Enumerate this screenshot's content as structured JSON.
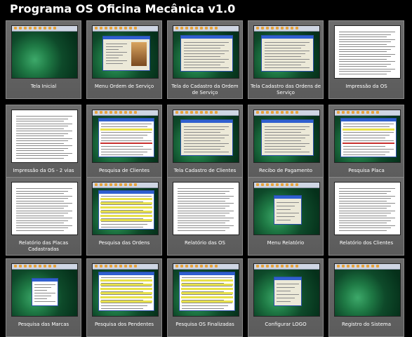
{
  "title": "Programa OS Oficina Mecânica v1.0",
  "cards": [
    {
      "caption": "Tela Inicial"
    },
    {
      "caption": "Menu Ordem de Serviço"
    },
    {
      "caption": "Tela do Cadastro da Ordem de Serviço"
    },
    {
      "caption": "Tela Cadastro das Ordens de Serviço"
    },
    {
      "caption": "Impressão da OS"
    },
    {
      "caption": "Impressão da OS - 2 vias"
    },
    {
      "caption": "Pesquisa de Clientes"
    },
    {
      "caption": "Tela Cadastro de Clientes"
    },
    {
      "caption": "Recibo de Pagamento"
    },
    {
      "caption": "Pesquisa Placa"
    },
    {
      "caption": "Relatório das Placas Cadastradas"
    },
    {
      "caption": "Pesquisa das Ordens"
    },
    {
      "caption": "Relatório das OS"
    },
    {
      "caption": "Menu Relatório"
    },
    {
      "caption": "Relatório dos Clientes"
    },
    {
      "caption": "Pesquisa das Marcas"
    },
    {
      "caption": "Pesquisa dos Pendentes"
    },
    {
      "caption": "Pesquisa OS Finalizadas"
    },
    {
      "caption": "Configurar LOGO"
    },
    {
      "caption": "Registro do Sistema"
    }
  ]
}
